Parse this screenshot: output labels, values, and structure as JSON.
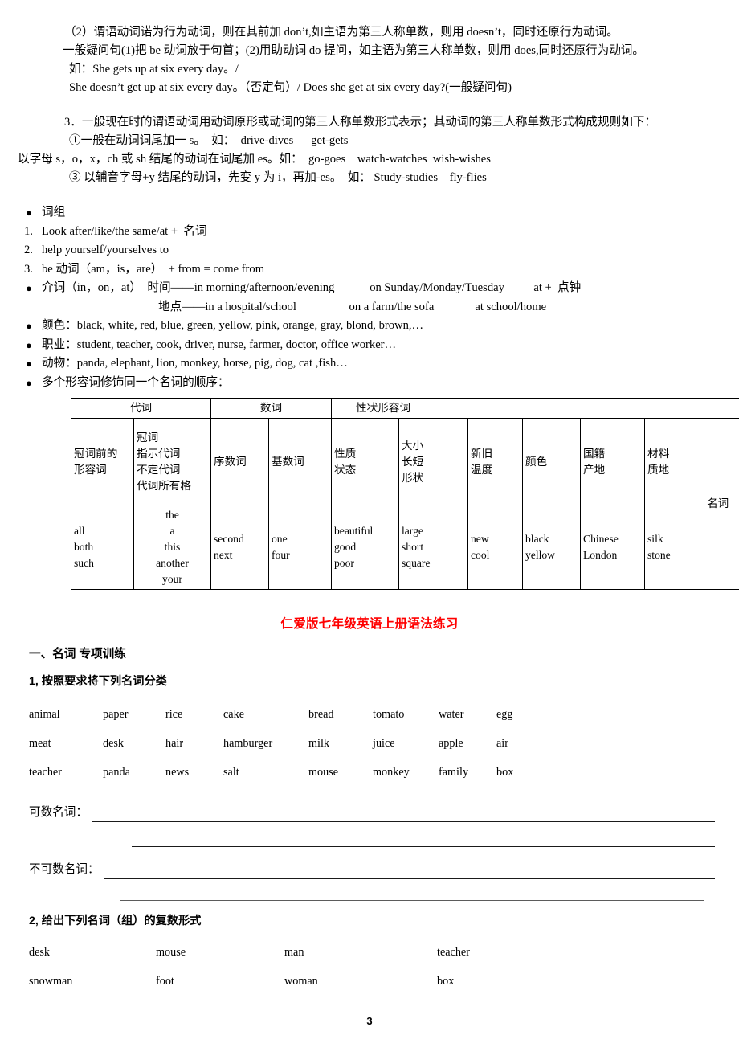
{
  "page": {
    "number": "3"
  },
  "notes": {
    "line_negative": "（2）谓语动词诺为行为动词，则在其前加 don’t,如主语为第三人称单数，则用 doesn’t，同时还原行为动词。",
    "line_question": "一般疑问句(1)把 be 动词放于句首；(2)用助动词 do 提问，如主语为第三人称单数，则用 does,同时还原行为动词。",
    "example_1": "如：She gets up at six every day。/",
    "example_2": "She doesn’t get up at six every day。（否定句）/ Does she get at six every day?(一般疑问句)",
    "rule_3_title": "3．一般现在时的谓语动词用动词原形或动词的第三人称单数形式表示；其动词的第三人称单数形式构成规则如下：",
    "rule_3_1": "①一般在动词词尾加一 s。  如：  drive-dives      get-gets",
    "rule_3_2": "以字母 s，o，x，ch 或 sh 结尾的动词在词尾加 es。如：  go-goes    watch-watches  wish-wishes",
    "rule_3_3": "③ 以辅音字母+y 结尾的动词，先变 y 为 i，再加-es。  如： Study-studies    fly-flies"
  },
  "phrases": {
    "heading": "词组",
    "items": [
      {
        "marker": "1.",
        "text": "Look after/like/the same/at +  名词"
      },
      {
        "marker": "2.",
        "text": "help yourself/yourselves to"
      },
      {
        "marker": "3.",
        "text": "be 动词（am，is，are）  + from = come from"
      }
    ]
  },
  "bullets": {
    "preposition": {
      "label": "介词（in，on，at）",
      "time_label": "时间——in morning/afternoon/evening",
      "time_col2": "on Sunday/Monday/Tuesday",
      "time_col3": "at +  点钟",
      "place_label": "地点——in a hospital/school",
      "place_col2": "on a farm/the sofa",
      "place_col3": "at school/home"
    },
    "colors": "颜色：black, white, red, blue, green, yellow, pink, orange, gray, blond, brown,…",
    "jobs": "职业：student, teacher, cook, driver, nurse, farmer, doctor, office worker…",
    "animals": "动物：panda, elephant, lion, monkey, horse, pig, dog, cat ,fish…",
    "adj_order": "多个形容词修饰同一个名词的顺序："
  },
  "adj_table": {
    "group_headers": {
      "pronoun": "代词",
      "numeral": "数词",
      "quality_adj": "性状形容词"
    },
    "sub_headers": {
      "pre_article_adj": "冠词前的\n形容词",
      "article_group": "冠词\n指示代词\n不定代词\n代词所有格",
      "ordinal": "序数词",
      "cardinal": "基数词",
      "quality_state": "性质\n状态",
      "size_shape": "大小\n长短\n形状",
      "age_temp": "新旧\n温度",
      "color": "颜色",
      "nationality": "国籍\n产地",
      "material": "材料\n质地",
      "noun": "名词"
    },
    "examples": {
      "pre_article_adj": "all\nboth\nsuch",
      "article_group": "the\na\nthis\nanother\nyour",
      "ordinal": "second\nnext",
      "cardinal": "one\nfour",
      "quality_state": "beautiful\ngood\npoor",
      "size_shape": "large\nshort\nsquare",
      "age_temp": "new\ncool",
      "color": "black\nyellow",
      "nationality": "Chinese\nLondon",
      "material": "silk\nstone"
    }
  },
  "exercise": {
    "red_title": "仁爱版七年级英语上册语法练习",
    "section_title": "一、名词 专项训练",
    "q1": {
      "title": "1, 按照要求将下列名词分类",
      "words": [
        [
          "animal",
          "paper",
          "rice",
          "cake",
          "bread",
          "tomato",
          "water",
          "egg"
        ],
        [
          "meat",
          "desk",
          "hair",
          "hamburger",
          "milk",
          "juice",
          "apple",
          "air"
        ],
        [
          "teacher",
          "panda",
          "news",
          "salt",
          "mouse",
          "monkey",
          "family",
          "box"
        ]
      ],
      "countable_label": "可数名词：",
      "uncountable_label": "不可数名词："
    },
    "q2": {
      "title": "2, 给出下列名词（组）的复数形式",
      "words": [
        [
          "desk",
          "mouse",
          "man",
          "teacher"
        ],
        [
          "snowman",
          "foot",
          "woman",
          "box"
        ]
      ]
    }
  },
  "colors": {
    "title_red": "#ff0000",
    "text": "#000000",
    "rule": "#3a3a3a"
  }
}
